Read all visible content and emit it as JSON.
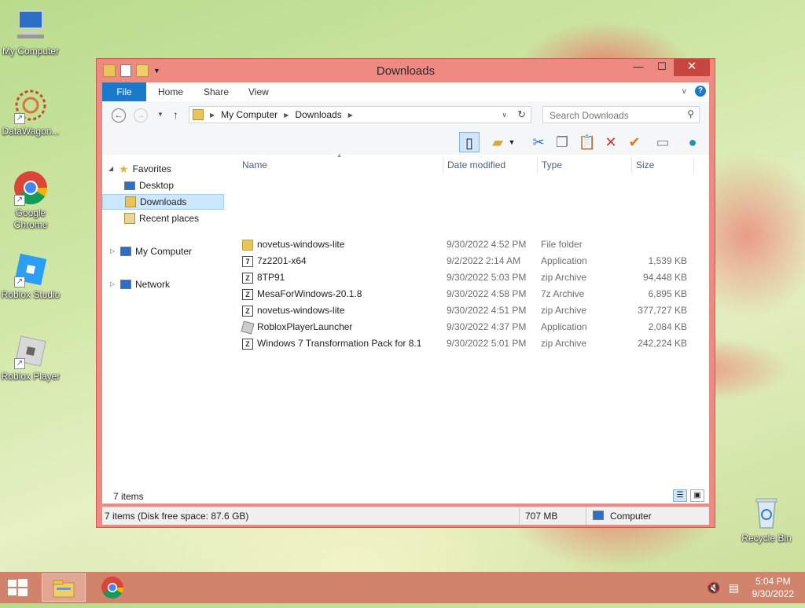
{
  "desktop": {
    "icons": [
      {
        "label": "My Computer"
      },
      {
        "label": "DataWagon..."
      },
      {
        "label": "Google Chrome"
      },
      {
        "label": "Roblox Studio"
      },
      {
        "label": "Roblox Player"
      },
      {
        "label": "Recycle Bin"
      }
    ]
  },
  "window": {
    "title": "Downloads",
    "controls": {
      "minimize": "—",
      "maximize": "☐",
      "close": "✕"
    },
    "ribbon_tabs": [
      "File",
      "Home",
      "Share",
      "View"
    ],
    "address": {
      "segments": [
        "My Computer",
        "Downloads"
      ]
    },
    "search": {
      "placeholder": "Search Downloads"
    },
    "nav_pane": {
      "favorites": "Favorites",
      "favorites_items": [
        "Desktop",
        "Downloads",
        "Recent places"
      ],
      "my_computer": "My Computer",
      "network": "Network",
      "selected": "Downloads"
    },
    "columns": {
      "name": "Name",
      "date": "Date modified",
      "type": "Type",
      "size": "Size"
    },
    "files": [
      {
        "name": "novetus-windows-lite",
        "date": "9/30/2022 4:52 PM",
        "type": "File folder",
        "size": "",
        "icon": "folder-icon"
      },
      {
        "name": "7z2201-x64",
        "date": "9/2/2022 2:14 AM",
        "type": "Application",
        "size": "1,539 KB",
        "icon": "7z-app-icon"
      },
      {
        "name": "8TP91",
        "date": "9/30/2022 5:03 PM",
        "type": "zip Archive",
        "size": "94,448 KB",
        "icon": "zip-icon"
      },
      {
        "name": "MesaForWindows-20.1.8",
        "date": "9/30/2022 4:58 PM",
        "type": "7z Archive",
        "size": "6,895 KB",
        "icon": "zip-icon"
      },
      {
        "name": "novetus-windows-lite",
        "date": "9/30/2022 4:51 PM",
        "type": "zip Archive",
        "size": "377,727 KB",
        "icon": "zip-icon"
      },
      {
        "name": "RobloxPlayerLauncher",
        "date": "9/30/2022 4:37 PM",
        "type": "Application",
        "size": "2,084 KB",
        "icon": "roblox-icon"
      },
      {
        "name": "Windows 7 Transformation Pack for 8.1",
        "date": "9/30/2022 5:01 PM",
        "type": "zip Archive",
        "size": "242,224 KB",
        "icon": "zip-icon"
      }
    ],
    "item_count": "7 items",
    "status": {
      "left": "7 items (Disk free space: 87.6 GB)",
      "middle": "707 MB",
      "right": "Computer"
    }
  },
  "taskbar": {
    "time": "5:04 PM",
    "date": "9/30/2022"
  }
}
